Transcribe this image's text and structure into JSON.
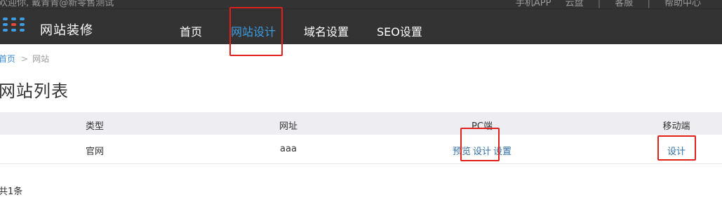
{
  "topbar": {
    "welcome_text": "欢迎你, 戴青青@新零售测试",
    "links": [
      "手机APP",
      "云盘",
      "客服",
      "帮助中心"
    ]
  },
  "navbar": {
    "site_title": "网站装修",
    "items": [
      {
        "label": "首页",
        "active": false
      },
      {
        "label": "网站设计",
        "active": true
      },
      {
        "label": "域名设置",
        "active": false
      },
      {
        "label": "SEO设置",
        "active": false
      }
    ],
    "accent_color": "#3c9ee5",
    "background_color": "#333333"
  },
  "breadcrumb": {
    "home": "首页",
    "separator": ">",
    "current": "网站"
  },
  "page": {
    "title": "网站列表"
  },
  "table": {
    "headers": {
      "type": "类型",
      "url": "网址",
      "pc": "PC端",
      "mobile": "移动端"
    },
    "rows": [
      {
        "type": "官网",
        "url": "aaa",
        "pc_actions": {
          "preview": "预览",
          "design": "设计",
          "settings": "设置"
        },
        "mobile_actions": {
          "design": "设计"
        }
      }
    ]
  },
  "footer": {
    "count_text": "共1条"
  },
  "highlight_color": "#e0211b"
}
